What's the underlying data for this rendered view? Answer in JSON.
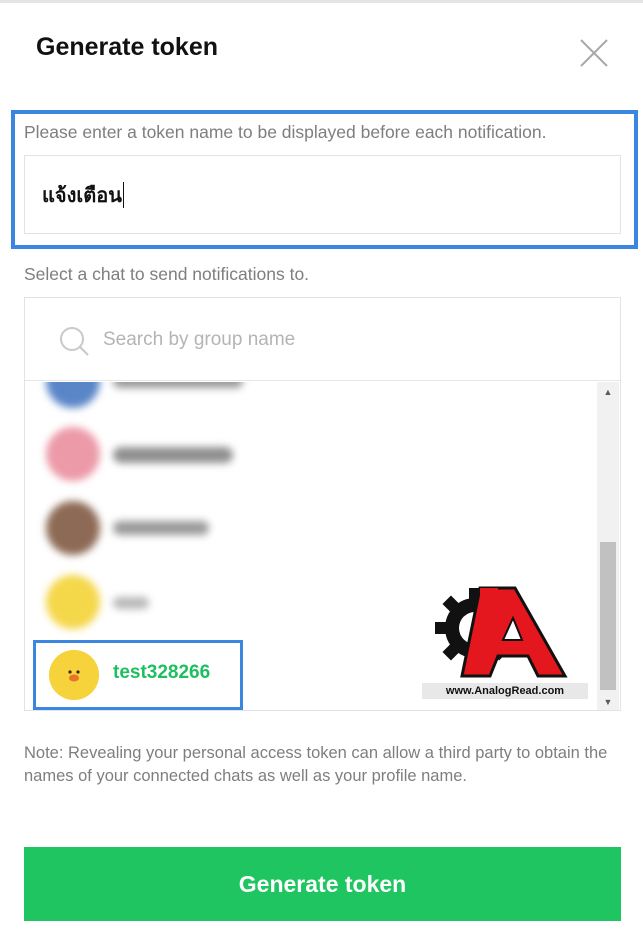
{
  "dialog": {
    "title": "Generate token"
  },
  "token_field": {
    "label": "Please enter a token name to be displayed before each notification.",
    "value": "แจ้งเตือน"
  },
  "chat_selector": {
    "label": "Select a chat to send notifications to.",
    "search_placeholder": "Search by group name",
    "selected_chat": "test328266",
    "colors": {
      "selected_text": "#1fbf60",
      "highlight": "#3b86e0"
    }
  },
  "watermark": {
    "text": "www.AnalogRead.com"
  },
  "note": {
    "text": "Note: Revealing your personal access token can allow a third party to obtain the names of your connected chats as well as your profile name."
  },
  "actions": {
    "generate_label": "Generate token",
    "button_color": "#1ec561"
  }
}
